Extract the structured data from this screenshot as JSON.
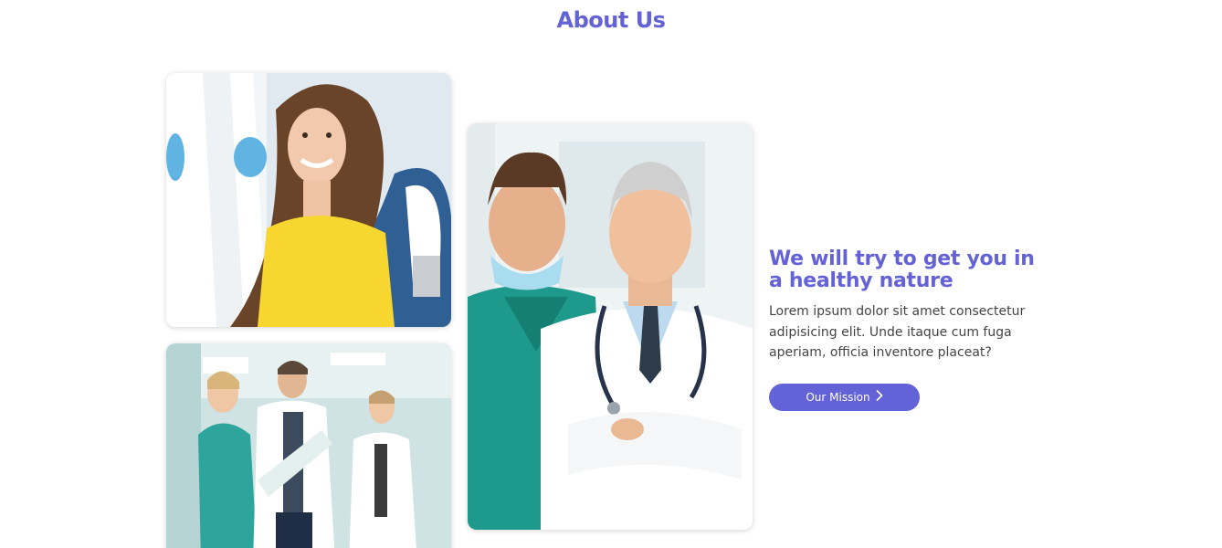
{
  "section": {
    "title": "About Us"
  },
  "images": {
    "dental": "Patient smiling in dental chair",
    "team": "Medical team walking in hospital corridor",
    "doctors": "Two doctors posing"
  },
  "content": {
    "headline": "We will try to get you in a healthy nature",
    "body": "Lorem ipsum dolor sit amet consectetur adipisicing elit. Unde itaque cum fuga aperiam, officia inventore placeat?",
    "button_label": "Our Mission",
    "button_icon": "chevron-right-icon"
  },
  "colors": {
    "accent": "#6362d6",
    "body_text": "#444444",
    "background": "#ffffff"
  }
}
